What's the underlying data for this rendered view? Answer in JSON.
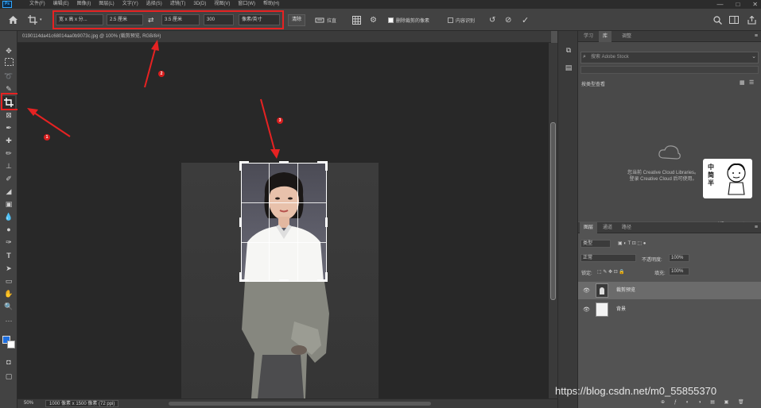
{
  "app": {
    "logo_text": "Ps",
    "menus": [
      "文件(F)",
      "编辑(E)",
      "图像(I)",
      "图层(L)",
      "文字(Y)",
      "选择(S)",
      "滤镜(T)",
      "3D(D)",
      "视图(V)",
      "窗口(W)",
      "帮助(H)"
    ],
    "window_controls": [
      "—",
      "□",
      "✕"
    ]
  },
  "options": {
    "ratio_select": "宽 x 高 x 分...",
    "width_value": "2.5 厘米",
    "height_value": "3.5 厘米",
    "resolution_value": "300",
    "resolution_unit": "像素/英寸",
    "clear_label": "清除",
    "straighten_label": "拉直",
    "delete_cropped_label": "删除裁剪的像素",
    "content_aware_label": "内容识别"
  },
  "document": {
    "tab_title": "0190114da41c68014aa0b9073c.jpg @ 100% (裁剪预览, RGB/8#)",
    "zoom": "50%",
    "doc_info": "1000 像素 x 1500 像素 (72 ppi)"
  },
  "annotations": {
    "marker_1": "1",
    "marker_2": "2",
    "marker_3": "3"
  },
  "right_panel": {
    "top_tabs": [
      "学习",
      "库",
      "调整"
    ],
    "library": {
      "search_placeholder": "搜索 Adobe Stock",
      "select_label": "按类型查看",
      "message_line1": "您当前 Creative Cloud Libraries。",
      "message_line2": "登录 Creative Cloud 后可使用。",
      "footer": "KB"
    },
    "layer_tabs": [
      "图层",
      "通道",
      "路径"
    ],
    "layers": {
      "filter_label": "类型",
      "blend_mode": "正常",
      "opacity_label": "不透明度:",
      "opacity_value": "100%",
      "lock_label": "锁定:",
      "fill_label": "填充:",
      "fill_value": "100%",
      "items": [
        {
          "name": "裁剪预览",
          "selected": true
        },
        {
          "name": "背景",
          "selected": false
        }
      ]
    }
  },
  "watermark": "https://blog.csdn.net/m0_55855370",
  "sticker_text": [
    "中",
    "简",
    "半"
  ]
}
